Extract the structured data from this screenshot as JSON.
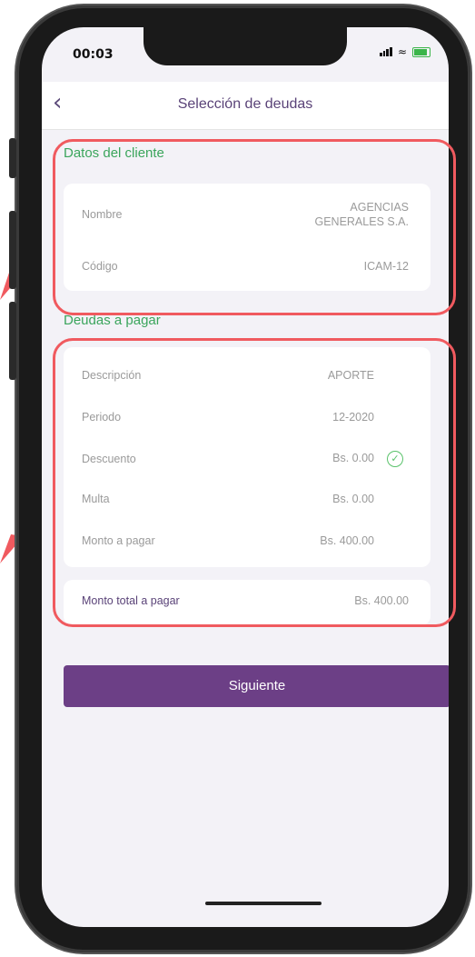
{
  "status": {
    "time": "00:03"
  },
  "navbar": {
    "back_label": "‹",
    "title": "Selección de deudas"
  },
  "client_section": {
    "title": "Datos del cliente",
    "rows": [
      {
        "label": "Nombre",
        "value_line1": "AGENCIAS",
        "value_line2": "GENERALES S.A."
      },
      {
        "label": "Código",
        "value": "ICAM-12"
      }
    ]
  },
  "debts_section": {
    "title": "Deudas a pagar",
    "rows": [
      {
        "label": "Descripción",
        "value": "APORTE"
      },
      {
        "label": "Periodo",
        "value": "12-2020"
      },
      {
        "label": "Descuento",
        "value": "Bs. 0.00"
      },
      {
        "label": "Multa",
        "value": "Bs. 0.00"
      },
      {
        "label": "Monto a pagar",
        "value": "Bs. 400.00"
      }
    ],
    "total": {
      "label": "Monto total a pagar",
      "value": "Bs. 400.00"
    }
  },
  "next_button": {
    "label": "Siguiente"
  },
  "colors": {
    "accent": "#6c3f86",
    "section_title": "#3ba55c",
    "highlight": "#f05a5f"
  }
}
